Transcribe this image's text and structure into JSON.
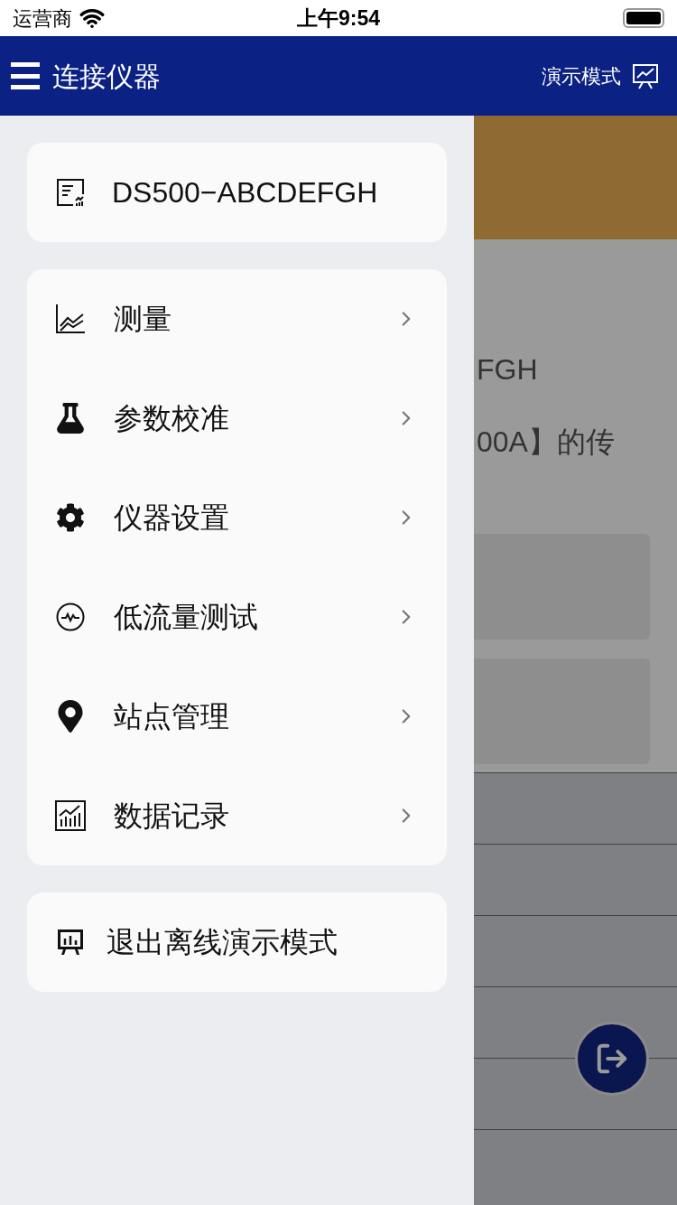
{
  "status_bar": {
    "carrier": "运营商",
    "time": "上午9:54"
  },
  "header": {
    "title": "连接仪器",
    "mode_label": "演示模式"
  },
  "background_page": {
    "line_1": "FGH",
    "line_2": "00A】的传"
  },
  "device_card": {
    "name": "DS500−ABCDEFGH"
  },
  "menu_items": [
    {
      "label": "测量"
    },
    {
      "label": "参数校准"
    },
    {
      "label": "仪器设置"
    },
    {
      "label": "低流量测试"
    },
    {
      "label": "站点管理"
    },
    {
      "label": "数据记录"
    }
  ],
  "exit_item": {
    "label": "退出离线演示模式"
  }
}
